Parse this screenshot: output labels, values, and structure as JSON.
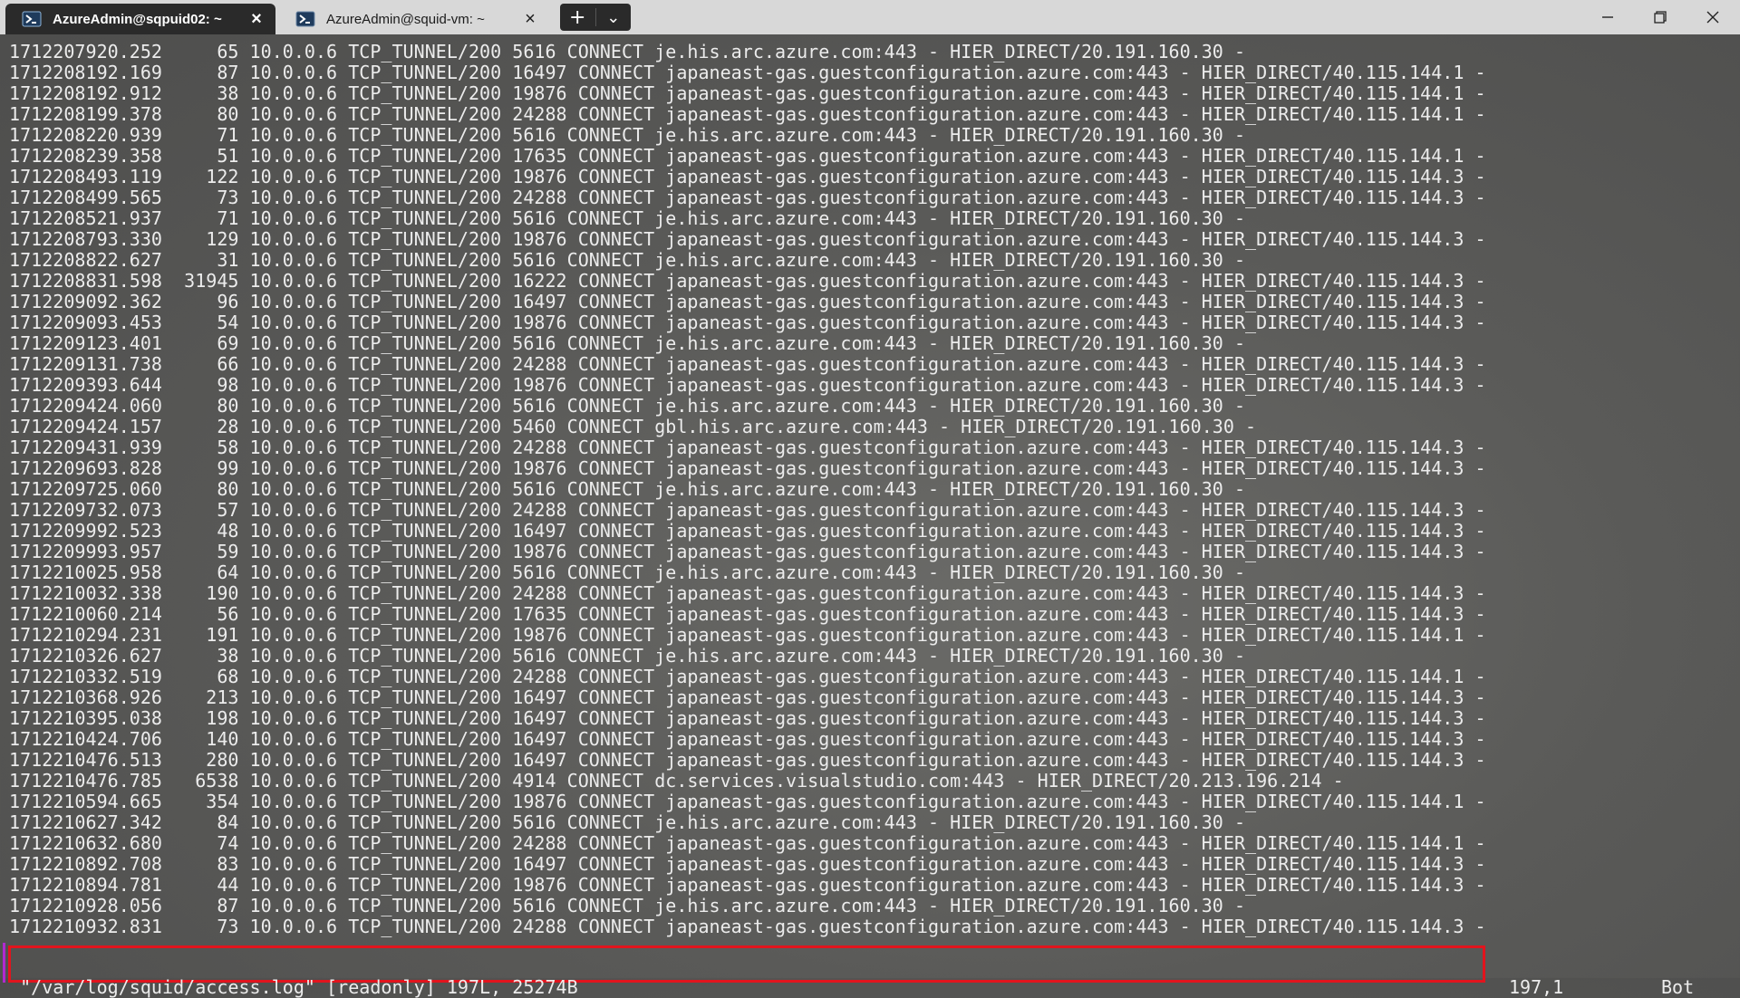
{
  "tabs": [
    {
      "label": "AzureAdmin@sqpuid02: ~",
      "icon": "powershell-icon"
    },
    {
      "label": "AzureAdmin@squid-vm: ~",
      "icon": "powershell-icon"
    }
  ],
  "new_tab": {
    "plus": "+",
    "dropdown": "⌄"
  },
  "window_controls": {
    "minimize": "─",
    "maximize": "❐",
    "close": "✕"
  },
  "terminal": {
    "lines": [
      "1712207920.252     65 10.0.0.6 TCP_TUNNEL/200 5616 CONNECT je.his.arc.azure.com:443 - HIER_DIRECT/20.191.160.30 -",
      "1712208192.169     87 10.0.0.6 TCP_TUNNEL/200 16497 CONNECT japaneast-gas.guestconfiguration.azure.com:443 - HIER_DIRECT/40.115.144.1 -",
      "1712208192.912     38 10.0.0.6 TCP_TUNNEL/200 19876 CONNECT japaneast-gas.guestconfiguration.azure.com:443 - HIER_DIRECT/40.115.144.1 -",
      "1712208199.378     80 10.0.0.6 TCP_TUNNEL/200 24288 CONNECT japaneast-gas.guestconfiguration.azure.com:443 - HIER_DIRECT/40.115.144.1 -",
      "1712208220.939     71 10.0.0.6 TCP_TUNNEL/200 5616 CONNECT je.his.arc.azure.com:443 - HIER_DIRECT/20.191.160.30 -",
      "1712208239.358     51 10.0.0.6 TCP_TUNNEL/200 17635 CONNECT japaneast-gas.guestconfiguration.azure.com:443 - HIER_DIRECT/40.115.144.1 -",
      "1712208493.119    122 10.0.0.6 TCP_TUNNEL/200 19876 CONNECT japaneast-gas.guestconfiguration.azure.com:443 - HIER_DIRECT/40.115.144.3 -",
      "1712208499.565     73 10.0.0.6 TCP_TUNNEL/200 24288 CONNECT japaneast-gas.guestconfiguration.azure.com:443 - HIER_DIRECT/40.115.144.3 -",
      "1712208521.937     71 10.0.0.6 TCP_TUNNEL/200 5616 CONNECT je.his.arc.azure.com:443 - HIER_DIRECT/20.191.160.30 -",
      "1712208793.330    129 10.0.0.6 TCP_TUNNEL/200 19876 CONNECT japaneast-gas.guestconfiguration.azure.com:443 - HIER_DIRECT/40.115.144.3 -",
      "1712208822.627     31 10.0.0.6 TCP_TUNNEL/200 5616 CONNECT je.his.arc.azure.com:443 - HIER_DIRECT/20.191.160.30 -",
      "1712208831.598  31945 10.0.0.6 TCP_TUNNEL/200 16222 CONNECT japaneast-gas.guestconfiguration.azure.com:443 - HIER_DIRECT/40.115.144.3 -",
      "1712209092.362     96 10.0.0.6 TCP_TUNNEL/200 16497 CONNECT japaneast-gas.guestconfiguration.azure.com:443 - HIER_DIRECT/40.115.144.3 -",
      "1712209093.453     54 10.0.0.6 TCP_TUNNEL/200 19876 CONNECT japaneast-gas.guestconfiguration.azure.com:443 - HIER_DIRECT/40.115.144.3 -",
      "1712209123.401     69 10.0.0.6 TCP_TUNNEL/200 5616 CONNECT je.his.arc.azure.com:443 - HIER_DIRECT/20.191.160.30 -",
      "1712209131.738     66 10.0.0.6 TCP_TUNNEL/200 24288 CONNECT japaneast-gas.guestconfiguration.azure.com:443 - HIER_DIRECT/40.115.144.3 -",
      "1712209393.644     98 10.0.0.6 TCP_TUNNEL/200 19876 CONNECT japaneast-gas.guestconfiguration.azure.com:443 - HIER_DIRECT/40.115.144.3 -",
      "1712209424.060     80 10.0.0.6 TCP_TUNNEL/200 5616 CONNECT je.his.arc.azure.com:443 - HIER_DIRECT/20.191.160.30 -",
      "1712209424.157     28 10.0.0.6 TCP_TUNNEL/200 5460 CONNECT gbl.his.arc.azure.com:443 - HIER_DIRECT/20.191.160.30 -",
      "1712209431.939     58 10.0.0.6 TCP_TUNNEL/200 24288 CONNECT japaneast-gas.guestconfiguration.azure.com:443 - HIER_DIRECT/40.115.144.3 -",
      "1712209693.828     99 10.0.0.6 TCP_TUNNEL/200 19876 CONNECT japaneast-gas.guestconfiguration.azure.com:443 - HIER_DIRECT/40.115.144.3 -",
      "1712209725.060     80 10.0.0.6 TCP_TUNNEL/200 5616 CONNECT je.his.arc.azure.com:443 - HIER_DIRECT/20.191.160.30 -",
      "1712209732.073     57 10.0.0.6 TCP_TUNNEL/200 24288 CONNECT japaneast-gas.guestconfiguration.azure.com:443 - HIER_DIRECT/40.115.144.3 -",
      "1712209992.523     48 10.0.0.6 TCP_TUNNEL/200 16497 CONNECT japaneast-gas.guestconfiguration.azure.com:443 - HIER_DIRECT/40.115.144.3 -",
      "1712209993.957     59 10.0.0.6 TCP_TUNNEL/200 19876 CONNECT japaneast-gas.guestconfiguration.azure.com:443 - HIER_DIRECT/40.115.144.3 -",
      "1712210025.958     64 10.0.0.6 TCP_TUNNEL/200 5616 CONNECT je.his.arc.azure.com:443 - HIER_DIRECT/20.191.160.30 -",
      "1712210032.338    190 10.0.0.6 TCP_TUNNEL/200 24288 CONNECT japaneast-gas.guestconfiguration.azure.com:443 - HIER_DIRECT/40.115.144.3 -",
      "1712210060.214     56 10.0.0.6 TCP_TUNNEL/200 17635 CONNECT japaneast-gas.guestconfiguration.azure.com:443 - HIER_DIRECT/40.115.144.3 -",
      "1712210294.231    191 10.0.0.6 TCP_TUNNEL/200 19876 CONNECT japaneast-gas.guestconfiguration.azure.com:443 - HIER_DIRECT/40.115.144.1 -",
      "1712210326.627     38 10.0.0.6 TCP_TUNNEL/200 5616 CONNECT je.his.arc.azure.com:443 - HIER_DIRECT/20.191.160.30 -",
      "1712210332.519     68 10.0.0.6 TCP_TUNNEL/200 24288 CONNECT japaneast-gas.guestconfiguration.azure.com:443 - HIER_DIRECT/40.115.144.1 -",
      "1712210368.926    213 10.0.0.6 TCP_TUNNEL/200 16497 CONNECT japaneast-gas.guestconfiguration.azure.com:443 - HIER_DIRECT/40.115.144.3 -",
      "1712210395.038    198 10.0.0.6 TCP_TUNNEL/200 16497 CONNECT japaneast-gas.guestconfiguration.azure.com:443 - HIER_DIRECT/40.115.144.3 -",
      "1712210424.706    140 10.0.0.6 TCP_TUNNEL/200 16497 CONNECT japaneast-gas.guestconfiguration.azure.com:443 - HIER_DIRECT/40.115.144.3 -",
      "1712210476.513    280 10.0.0.6 TCP_TUNNEL/200 16497 CONNECT japaneast-gas.guestconfiguration.azure.com:443 - HIER_DIRECT/40.115.144.3 -",
      "1712210476.785   6538 10.0.0.6 TCP_TUNNEL/200 4914 CONNECT dc.services.visualstudio.com:443 - HIER_DIRECT/20.213.196.214 -",
      "1712210594.665    354 10.0.0.6 TCP_TUNNEL/200 19876 CONNECT japaneast-gas.guestconfiguration.azure.com:443 - HIER_DIRECT/40.115.144.1 -",
      "1712210627.342     84 10.0.0.6 TCP_TUNNEL/200 5616 CONNECT je.his.arc.azure.com:443 - HIER_DIRECT/20.191.160.30 -",
      "1712210632.680     74 10.0.0.6 TCP_TUNNEL/200 24288 CONNECT japaneast-gas.guestconfiguration.azure.com:443 - HIER_DIRECT/40.115.144.1 -",
      "1712210892.708     83 10.0.0.6 TCP_TUNNEL/200 16497 CONNECT japaneast-gas.guestconfiguration.azure.com:443 - HIER_DIRECT/40.115.144.3 -",
      "1712210894.781     44 10.0.0.6 TCP_TUNNEL/200 19876 CONNECT japaneast-gas.guestconfiguration.azure.com:443 - HIER_DIRECT/40.115.144.3 -",
      "1712210928.056     87 10.0.0.6 TCP_TUNNEL/200 5616 CONNECT je.his.arc.azure.com:443 - HIER_DIRECT/20.191.160.30 -",
      "1712210932.831     73 10.0.0.6 TCP_TUNNEL/200 24288 CONNECT japaneast-gas.guestconfiguration.azure.com:443 - HIER_DIRECT/40.115.144.3 -"
    ],
    "status_file": " \"/var/log/squid/access.log\" [readonly] 197L, 25274B",
    "status_position": "197,1",
    "status_scroll": "Bot"
  },
  "colors": {
    "highlight_border": "#e2141d",
    "terminal_text": "#ececec",
    "tab_active_bg": "#2a2a2a"
  }
}
